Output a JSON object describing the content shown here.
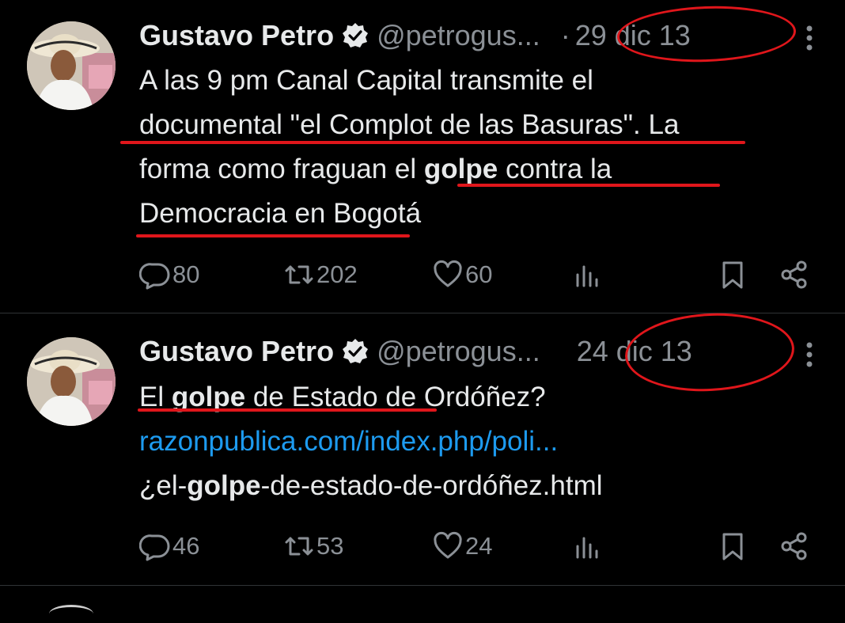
{
  "tweets": [
    {
      "name": "Gustavo Petro",
      "handle": "@petrogus...",
      "separator": "·",
      "date": "29 dic 13",
      "text": {
        "l1": "A las 9 pm Canal Capital transmite el",
        "l2": "documental \"el Complot de las Basuras\". La",
        "l3a": "forma como fraguan el ",
        "l3b": "golpe",
        "l3c": " contra la",
        "l4": "Democracia en Bogotá"
      },
      "replies": "80",
      "retweets": "202",
      "likes": "60"
    },
    {
      "name": "Gustavo Petro",
      "handle": "@petrogus...",
      "separator": "",
      "date": "24 dic 13",
      "text": {
        "l1a": "El ",
        "l1b": "golpe",
        "l1c": " de Estado de Ordóñez?",
        "link": "razonpublica.com/index.php/poli...",
        "l3a": "¿el-",
        "l3b": "golpe",
        "l3c": "-de-estado-de-ordóñez.html"
      },
      "replies": "46",
      "retweets": "53",
      "likes": "24"
    }
  ],
  "icons": {
    "verified": "verified-badge-icon",
    "reply": "reply-icon",
    "retweet": "retweet-icon",
    "like": "heart-icon",
    "views": "views-icon",
    "bookmark": "bookmark-icon",
    "share": "share-icon",
    "more": "more-icon"
  },
  "colors": {
    "accent_link": "#1d9bf0",
    "annotation_red": "#e0161b"
  }
}
